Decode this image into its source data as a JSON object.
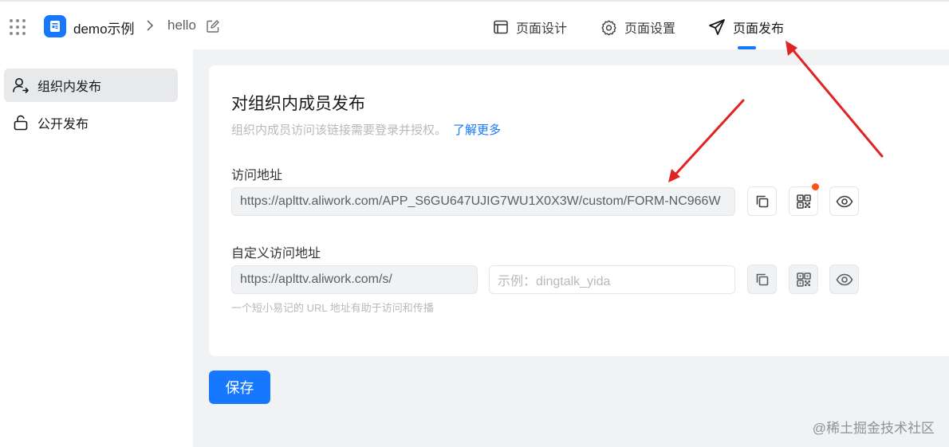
{
  "header": {
    "app_name": "demo示例",
    "page_name": "hello",
    "tabs": [
      {
        "label": "页面设计",
        "icon": "layout-icon"
      },
      {
        "label": "页面设置",
        "icon": "gear-icon"
      },
      {
        "label": "页面发布",
        "icon": "send-icon",
        "active": true
      }
    ]
  },
  "sidebar": {
    "items": [
      {
        "label": "组织内发布",
        "icon": "user-share-icon",
        "active": true
      },
      {
        "label": "公开发布",
        "icon": "unlock-icon",
        "active": false
      }
    ]
  },
  "publish": {
    "title": "对组织内成员发布",
    "description": "组织内成员访问该链接需要登录并授权。",
    "learn_more": "了解更多",
    "access_url_label": "访问地址",
    "access_url_value": "https://aplttv.aliwork.com/APP_S6GU647UJIG7WU1X0X3W/custom/FORM-NC966W",
    "custom_url_label": "自定义访问地址",
    "custom_url_prefix": "https://aplttv.aliwork.com/s/",
    "custom_url_placeholder": "示例：dingtalk_yida",
    "custom_url_hint": "一个短小易记的 URL 地址有助于访问和传播"
  },
  "footer": {
    "save_label": "保存",
    "watermark": "@稀土掘金技术社区"
  },
  "colors": {
    "accent": "#1677ff",
    "notification_dot": "#ff5219",
    "annotation_arrow": "#e02424"
  }
}
